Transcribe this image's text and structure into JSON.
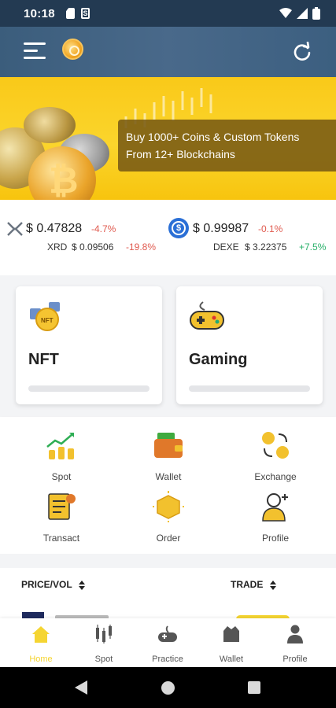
{
  "status_bar": {
    "time": "10:18"
  },
  "banner": {
    "promo_line1": "Buy 1000+ Coins & Custom Tokens",
    "promo_line2": "From 12+ Blockchains"
  },
  "ticker": [
    {
      "price": "$ 0.47828",
      "change": "-4.7%",
      "sub_symbol": "XRD",
      "sub_price": "$ 0.09506",
      "sub_change": "-19.8%",
      "sub_trend": "down"
    },
    {
      "price": "$ 0.99987",
      "change": "-0.1%",
      "sub_symbol": "DEXE",
      "sub_price": "$ 3.22375",
      "sub_change": "+7.5%",
      "sub_trend": "up"
    }
  ],
  "categories": [
    {
      "label": "NFT",
      "icon": "nft-icon"
    },
    {
      "label": "Gaming",
      "icon": "gamepad-icon"
    }
  ],
  "quick_actions": [
    {
      "label": "Spot",
      "icon": "spot-chart-icon"
    },
    {
      "label": "Wallet",
      "icon": "wallet-icon"
    },
    {
      "label": "Exchange",
      "icon": "exchange-icon"
    },
    {
      "label": "Transact",
      "icon": "transact-icon"
    },
    {
      "label": "Order",
      "icon": "order-icon"
    },
    {
      "label": "Profile",
      "icon": "profile-icon"
    }
  ],
  "trade_table": {
    "col_price_vol": "PRICE/VOL",
    "col_trade": "TRADE"
  },
  "bottom_nav": [
    {
      "label": "Home",
      "icon": "home-icon",
      "active": true
    },
    {
      "label": "Spot",
      "icon": "candles-icon",
      "active": false
    },
    {
      "label": "Practice",
      "icon": "practice-icon",
      "active": false
    },
    {
      "label": "Wallet",
      "icon": "wallet-icon",
      "active": false
    },
    {
      "label": "Profile",
      "icon": "person-icon",
      "active": false
    }
  ],
  "colors": {
    "accent": "#f5d532",
    "negative": "#e05a4f",
    "positive": "#29b06a",
    "appbar": "#3b5d7c"
  }
}
